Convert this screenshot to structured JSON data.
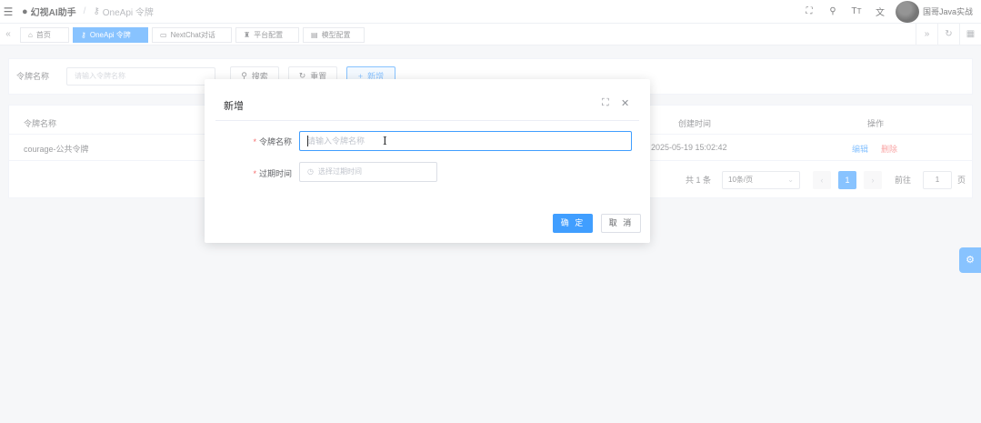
{
  "header": {
    "app_title": "幻视AI助手",
    "breadcrumb_separator": "/",
    "breadcrumb": "OneApi 令牌",
    "user_name": "国哥Java实战",
    "icons": [
      "fullscreen-icon",
      "search-icon",
      "font-size-icon",
      "translate-icon"
    ]
  },
  "tabs": [
    {
      "label": "首页",
      "icon": "home-icon",
      "active": false
    },
    {
      "label": "OneApi 令牌",
      "icon": "key-icon",
      "active": true
    },
    {
      "label": "NextChat对话",
      "icon": "chat-icon",
      "active": false
    },
    {
      "label": "平台配置",
      "icon": "config-icon",
      "active": false
    },
    {
      "label": "模型配置",
      "icon": "model-icon",
      "active": false
    }
  ],
  "search": {
    "label": "令牌名称",
    "placeholder": "请输入令牌名称",
    "search_button": "搜索",
    "reset_button": "重置",
    "add_button": "新增"
  },
  "table": {
    "columns": [
      "令牌名称",
      "创建时间",
      "操作"
    ],
    "rows": [
      {
        "name": "courage-公共令牌",
        "created": "2025-05-19 15:02:42",
        "edit": "编辑",
        "delete": "删除"
      }
    ]
  },
  "pagination": {
    "total_text": "共 1 条",
    "page_size": "10条/页",
    "current_page": "1",
    "goto_label": "前往",
    "goto_value": "1",
    "page_suffix": "页"
  },
  "dialog": {
    "title": "新增",
    "name_label": "令牌名称",
    "name_placeholder": "请输入令牌名称",
    "expire_label": "过期时间",
    "expire_placeholder": "选择过期时间",
    "required_mark": "*",
    "ok_button": "确 定",
    "cancel_button": "取 消"
  },
  "colors": {
    "primary": "#409eff",
    "danger": "#f56c6c",
    "text": "#606266"
  }
}
